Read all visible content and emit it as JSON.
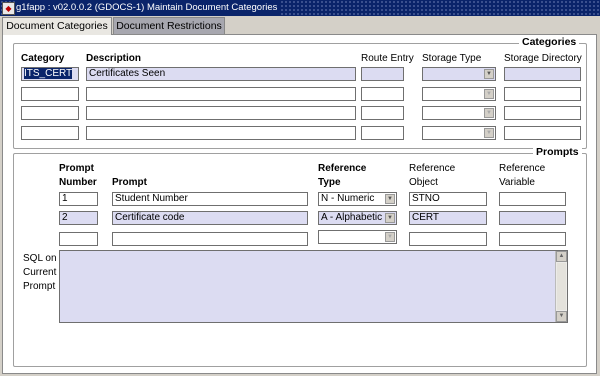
{
  "window": {
    "title": "g1fapp : v02.0.0.2  (GDOCS-1) Maintain Document Categories"
  },
  "tabs": [
    {
      "label": "Document Categories"
    },
    {
      "label": "Document Restrictions"
    }
  ],
  "categories": {
    "group_title": "Categories",
    "headers": {
      "category": "Category",
      "description": "Description",
      "route_entry": "Route Entry",
      "storage_type": "Storage Type",
      "storage_directory": "Storage Directory"
    },
    "rows": [
      {
        "category": "ITS_CERT",
        "description": "Certificates Seen",
        "route_entry": "",
        "storage_type": "",
        "storage_directory": ""
      },
      {
        "category": "",
        "description": "",
        "route_entry": "",
        "storage_type": "",
        "storage_directory": ""
      },
      {
        "category": "",
        "description": "",
        "route_entry": "",
        "storage_type": "",
        "storage_directory": ""
      },
      {
        "category": "",
        "description": "",
        "route_entry": "",
        "storage_type": "",
        "storage_directory": ""
      }
    ]
  },
  "prompts": {
    "group_title": "Prompts",
    "headers": {
      "prompt_number_1": "Prompt",
      "prompt_number_2": "Number",
      "prompt": "Prompt",
      "reference_type_1": "Reference",
      "reference_type_2": "Type",
      "reference_object_1": "Reference",
      "reference_object_2": "Object",
      "reference_variable_1": "Reference",
      "reference_variable_2": "Variable"
    },
    "rows": [
      {
        "number": "1",
        "prompt": "Student Number",
        "reference_type": "N - Numeric",
        "reference_object": "STNO",
        "reference_variable": ""
      },
      {
        "number": "2",
        "prompt": "Certificate code",
        "reference_type": "A - Alphabetic",
        "reference_object": "CERT",
        "reference_variable": ""
      },
      {
        "number": "",
        "prompt": "",
        "reference_type": "",
        "reference_object": "",
        "reference_variable": ""
      }
    ],
    "sql_label_1": "SQL on",
    "sql_label_2": "Current",
    "sql_label_3": "Prompt",
    "sql_value": ""
  },
  "colors": {
    "field_filled": "#dcdcf2",
    "title_bar": "#0a246a",
    "selection": "#0a246a"
  }
}
